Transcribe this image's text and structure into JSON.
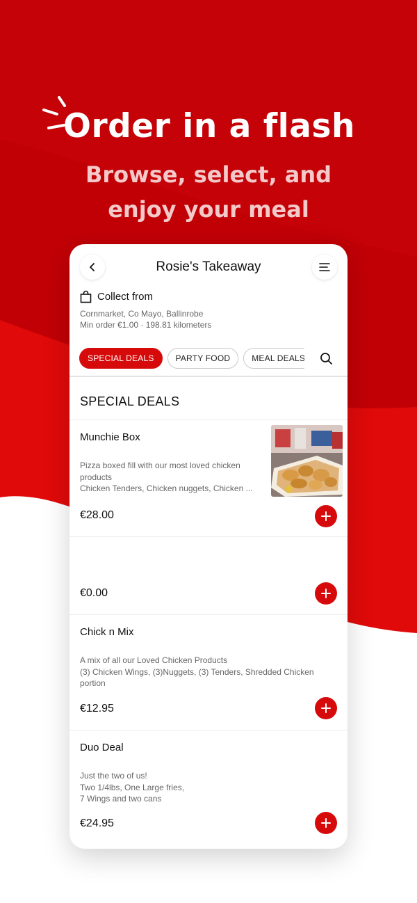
{
  "hero": {
    "headline": "Order in a flash",
    "subline_1": "Browse, select, and",
    "subline_2": "enjoy your meal"
  },
  "app": {
    "title": "Rosie's Takeaway",
    "collect_label": "Collect from",
    "address": "Cornmarket, Co Mayo, Ballinrobe",
    "min_order": "Min order €1.00 · 198.81 kilometers",
    "chips": [
      "SPECIAL DEALS",
      "PARTY FOOD",
      "MEAL DEALS"
    ],
    "section_title": "SPECIAL DEALS",
    "items": [
      {
        "name": "Munchie Box",
        "desc": [
          "Pizza boxed fill with our most loved chicken",
          "products",
          "Chicken Tenders, Chicken nuggets, Chicken ..."
        ],
        "price": "€28.00"
      },
      {
        "name": "",
        "desc": [],
        "price": "€0.00"
      },
      {
        "name": "Chick n Mix",
        "desc": [
          "A mix of all our Loved Chicken Products",
          "(3) Chicken Wings, (3)Nuggets, (3) Tenders, Shredded Chicken",
          "portion"
        ],
        "price": "€12.95"
      },
      {
        "name": "Duo Deal",
        "desc": [
          "Just the two of us!",
          "Two 1/4lbs, One Large fries,",
          "7 Wings and two cans"
        ],
        "price": "€24.95"
      }
    ]
  },
  "colors": {
    "brand_red": "#d60a0a",
    "background_red": "#c20006"
  },
  "icons": [
    "chevron-left-icon",
    "menu-icon",
    "shopping-bag-icon",
    "search-icon",
    "plus-icon",
    "flash-marks-icon"
  ]
}
